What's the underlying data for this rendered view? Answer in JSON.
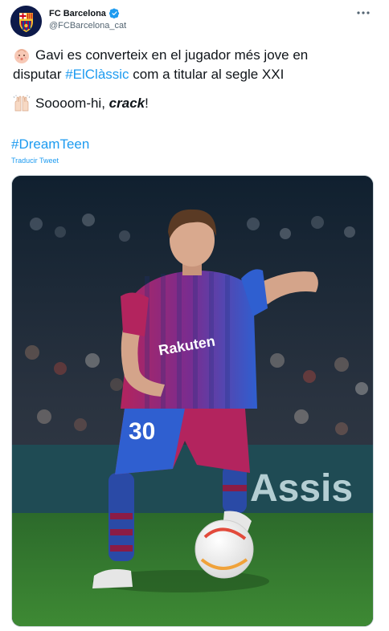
{
  "account": {
    "display_name": "FC Barcelona",
    "handle": "@FCBarcelona_cat",
    "avatar_icon": "fcb-crest",
    "verified_icon": "verified-badge"
  },
  "more_icon": "more-options-icon",
  "tweet": {
    "line1_emoji": "baby-face",
    "line1_a": "Gavi es converteix en el jugador més jove en",
    "line2_a": "disputar ",
    "line2_hashtag": "#ElClàssic",
    "line2_b": " com a titular al segle XXI",
    "line3_emoji": "raising-hands",
    "line3_a": "Soooom-hi, ",
    "line3_bold": "crack",
    "line3_b": "!",
    "hashtag": "#DreamTeen",
    "translate_label": "Traducir Tweet"
  },
  "media": {
    "description_image": "football-player-photo",
    "shirt_sponsor": "Rakuten",
    "shirt_number": "30",
    "board_text": "Assis"
  },
  "colors": {
    "link": "#1d9bf0",
    "secondary_text": "#536471",
    "pitch": "#2f6b2a",
    "shirt_blue": "#2b4fb3",
    "shirt_garnet": "#a51e5a"
  }
}
